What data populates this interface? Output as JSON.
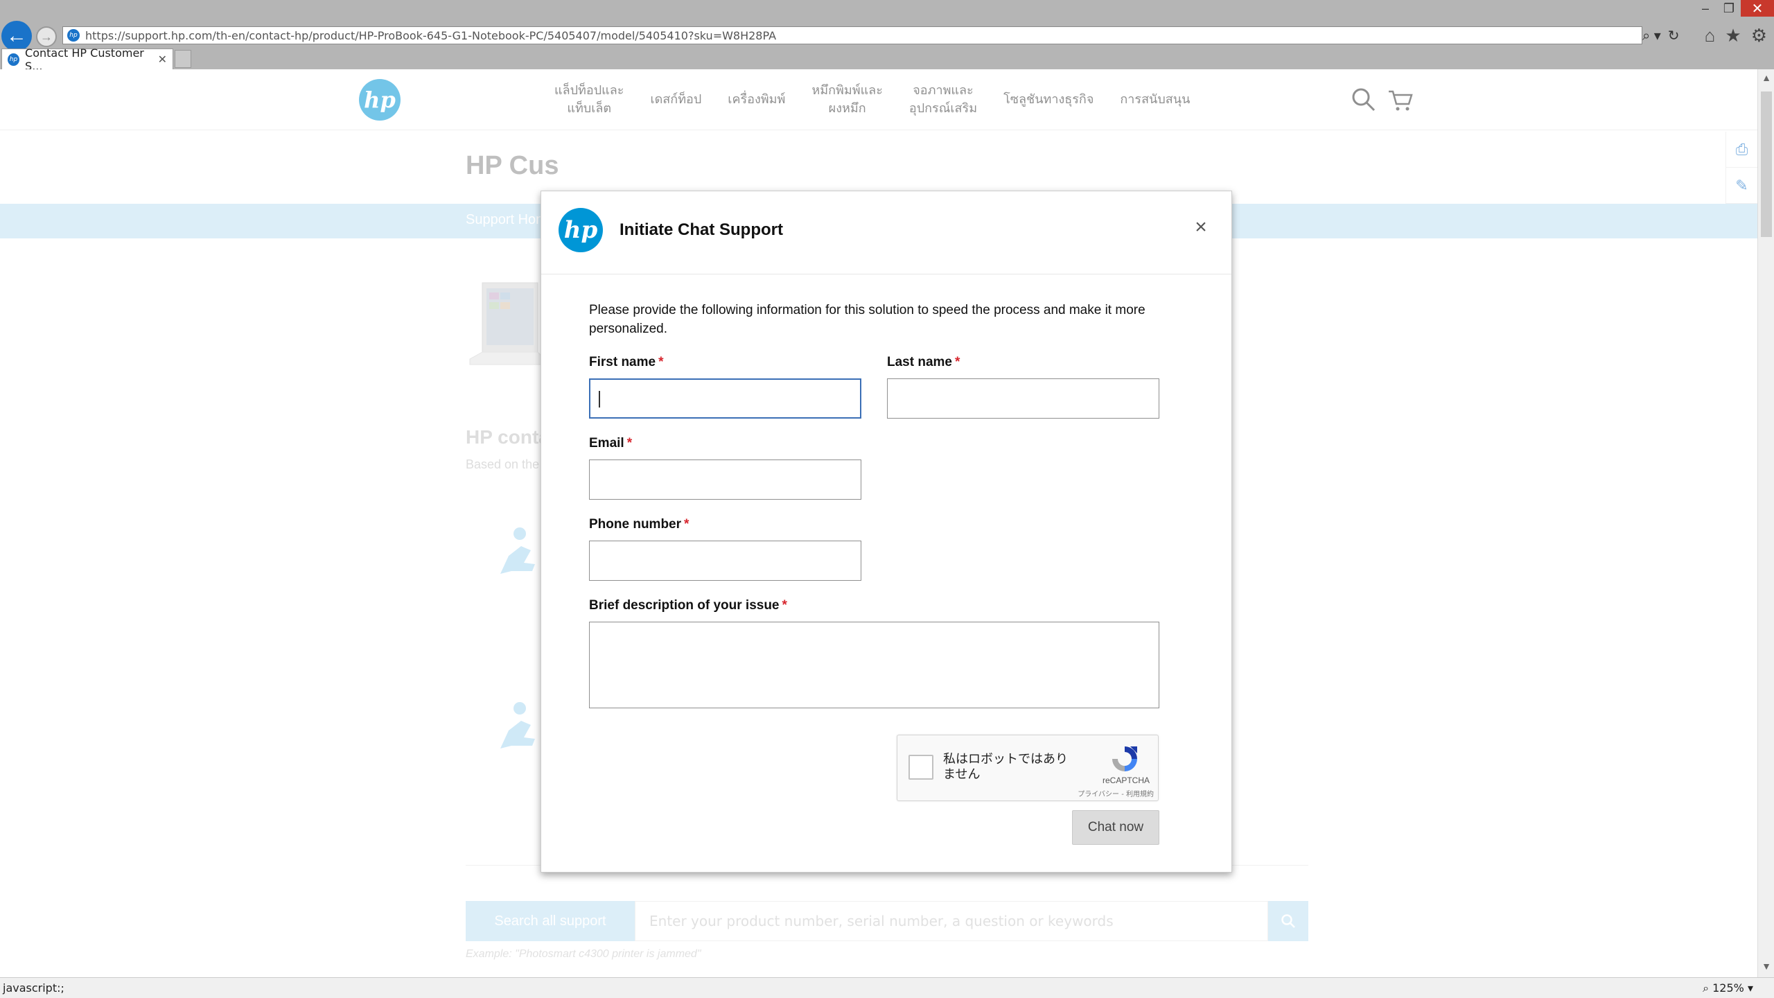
{
  "browser": {
    "url": "https://support.hp.com/th-en/contact-hp/product/HP-ProBook-645-G1-Notebook-PC/5405407/model/5405410?sku=W8H28PA",
    "tab_title": "Contact HP Customer S...",
    "status_text": "javascript:;",
    "zoom": "125%"
  },
  "site": {
    "logo_text": "hp",
    "nav": [
      {
        "line1": "แล็ปท็อปและ",
        "line2": "แท็บเล็ต"
      },
      {
        "line1": "เดสก์ท็อป",
        "line2": ""
      },
      {
        "line1": "เครื่องพิมพ์",
        "line2": ""
      },
      {
        "line1": "หมึกพิมพ์และ",
        "line2": "ผงหมึก"
      },
      {
        "line1": "จอภาพและ",
        "line2": "อุปกรณ์เสริม"
      },
      {
        "line1": "โซลูชันทางธุรกิจ",
        "line2": ""
      },
      {
        "line1": "การสนับสนุน",
        "line2": ""
      }
    ],
    "page_title": "HP Cus",
    "band_text": "Support Hom",
    "contact_title": "HP conta",
    "contact_sub": "Based on the",
    "search": {
      "label": "Search all support",
      "placeholder": "Enter your product number, serial number, a question or keywords",
      "example": "Example: \"Photosmart c4300 printer is jammed\""
    }
  },
  "modal": {
    "logo_text": "hp",
    "title": "Initiate Chat Support",
    "close": "×",
    "intro": "Please provide the following information for this solution to speed the process and make it more personalized.",
    "fields": {
      "first_name": {
        "label": "First name",
        "value": ""
      },
      "last_name": {
        "label": "Last name",
        "value": ""
      },
      "email": {
        "label": "Email",
        "value": ""
      },
      "phone": {
        "label": "Phone number",
        "value": ""
      },
      "issue": {
        "label": "Brief description of your issue",
        "value": ""
      }
    },
    "required_mark": "*",
    "recaptcha": {
      "text": "私はロボットではありません",
      "brand": "reCAPTCHA",
      "links": "プライバシー - 利用規約"
    },
    "submit_label": "Chat now"
  },
  "colors": {
    "hp_blue": "#0096d6",
    "band_blue": "#bfe0f3",
    "required_red": "#d7262e",
    "focus_border": "#3b6fb6"
  }
}
